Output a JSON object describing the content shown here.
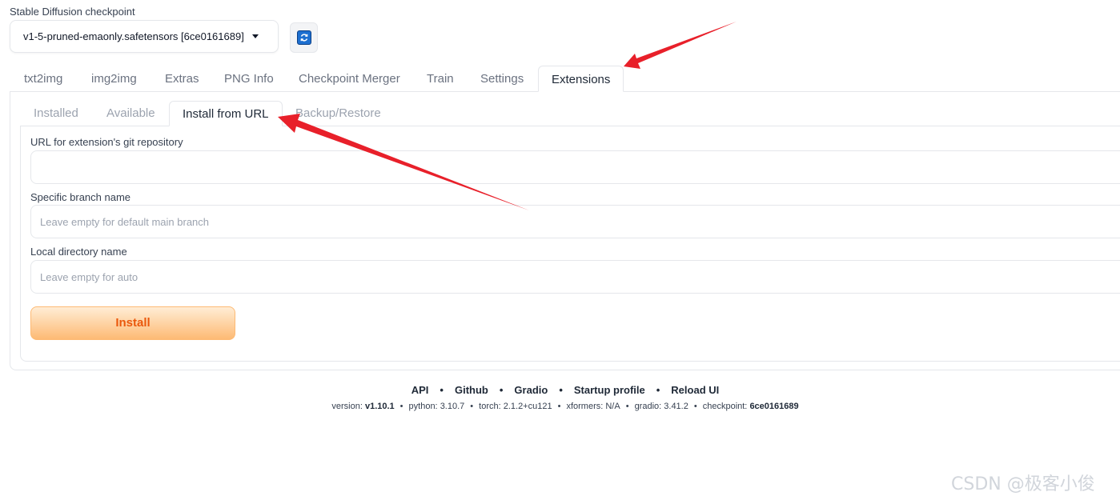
{
  "checkpoint": {
    "label": "Stable Diffusion checkpoint",
    "selected": "v1-5-pruned-emaonly.safetensors [6ce0161689]"
  },
  "main_tabs": [
    "txt2img",
    "img2img",
    "Extras",
    "PNG Info",
    "Checkpoint Merger",
    "Train",
    "Settings",
    "Extensions"
  ],
  "sub_tabs": [
    "Installed",
    "Available",
    "Install from URL",
    "Backup/Restore"
  ],
  "form": {
    "url_label": "URL for extension's git repository",
    "url_value": "",
    "branch_label": "Specific branch name",
    "branch_placeholder": "Leave empty for default main branch",
    "dir_label": "Local directory name",
    "dir_placeholder": "Leave empty for auto",
    "install_label": "Install"
  },
  "footer": {
    "links": [
      "API",
      "Github",
      "Gradio",
      "Startup profile",
      "Reload UI"
    ],
    "separator": "•",
    "versions": [
      {
        "key": "version:",
        "value": "v1.10.1"
      },
      {
        "key": "python:",
        "value": "3.10.7"
      },
      {
        "key": "torch:",
        "value": "2.1.2+cu121"
      },
      {
        "key": "xformers:",
        "value": "N/A"
      },
      {
        "key": "gradio:",
        "value": "3.41.2"
      },
      {
        "key": "checkpoint:",
        "value": "6ce0161689"
      }
    ]
  },
  "watermark": "CSDN @极客小俊",
  "colors": {
    "accent": "#ea580c",
    "annotation_arrow": "#e8202a"
  }
}
